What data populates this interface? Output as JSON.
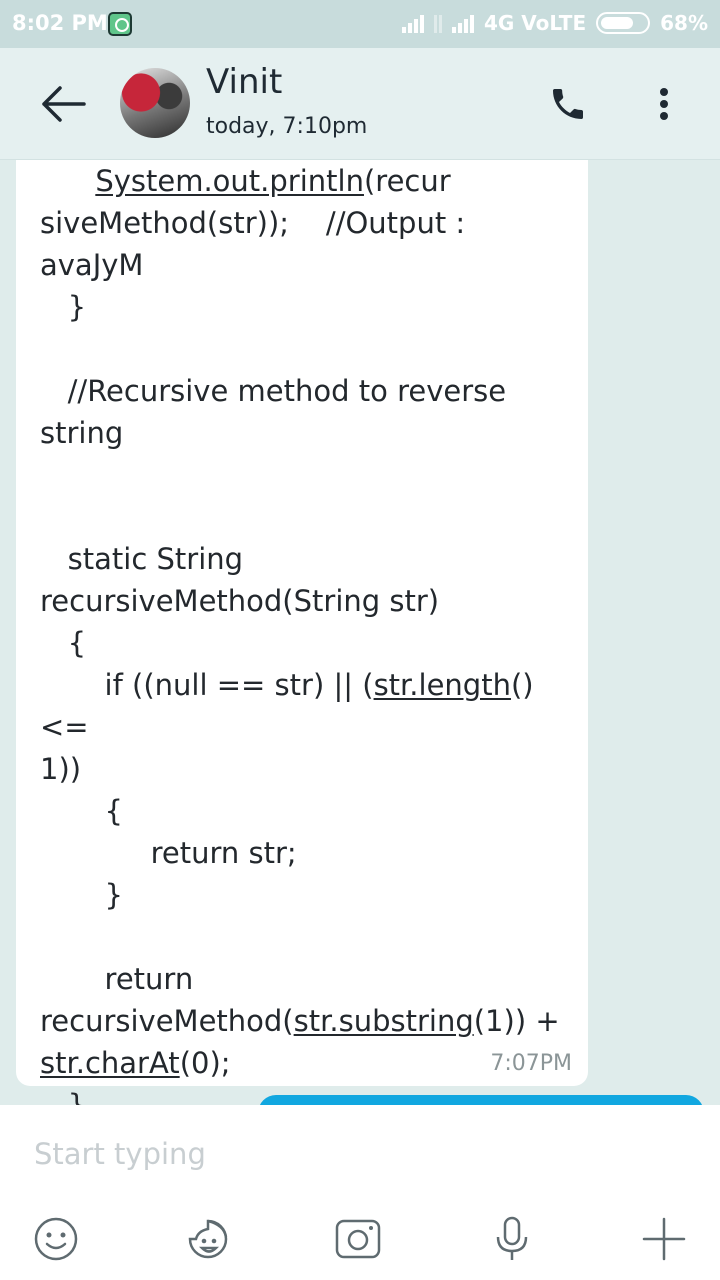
{
  "status_bar": {
    "time": "8:02 PM",
    "network": "4G VoLTE",
    "battery": "68%"
  },
  "header": {
    "contact_name": "Vinit",
    "last_seen": "today, 7:10pm"
  },
  "message": {
    "lines": [
      "      System.out.println(recursiveMethod(str));    //Output : avaJyM",
      "   }",
      "",
      "   //Recursive method to reverse string",
      "",
      "   static String recursiveMethod(String str)",
      "   {",
      "       if ((null == str) || (str.length() <= 1))",
      "       {",
      "            return str;",
      "       }",
      "",
      "       return recursiveMethod(str.substring(1)) + str.charAt(0);",
      "   }",
      "}"
    ],
    "timestamp": "7:07PM"
  },
  "compose": {
    "placeholder": "Start typing"
  },
  "icons": {
    "back": "arrow-left-icon",
    "call": "phone-icon",
    "more": "more-vertical-icon",
    "emoji": "smiley-icon",
    "sticker": "sticker-face-icon",
    "camera": "camera-icon",
    "mic": "microphone-icon",
    "add": "plus-icon"
  },
  "colors": {
    "accent": "#11a7e0",
    "header_bg": "#e5f0f0",
    "chat_bg": "#dfeceb"
  }
}
